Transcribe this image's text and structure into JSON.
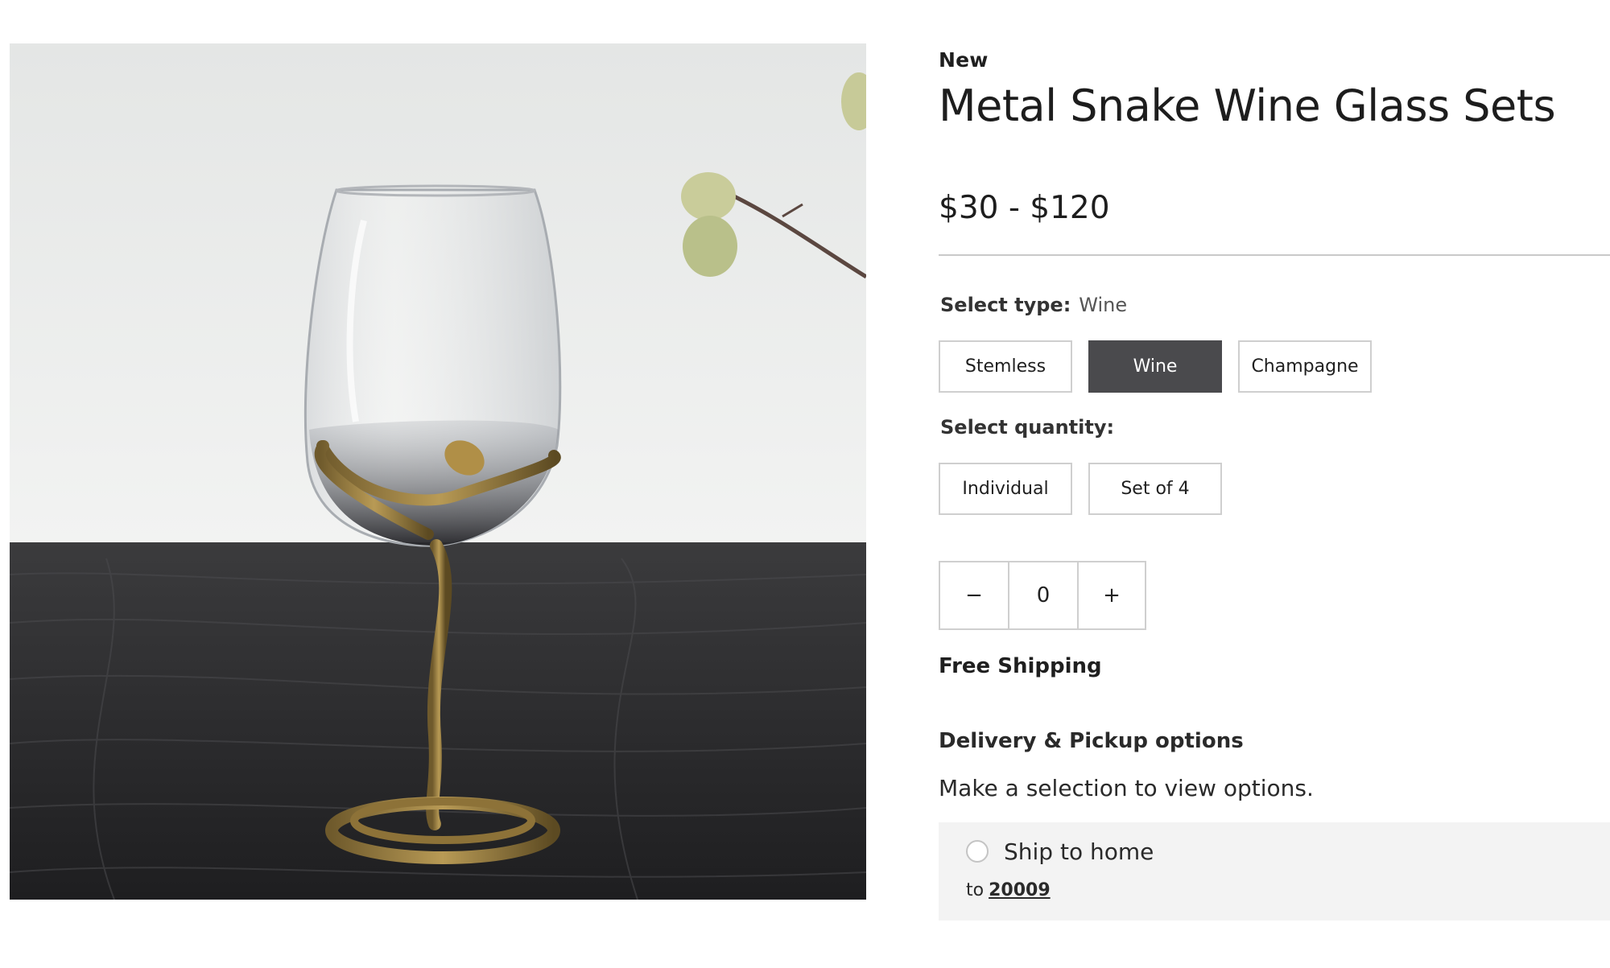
{
  "product": {
    "badge": "New",
    "title": "Metal Snake Wine Glass Sets",
    "price": "$30 - $120",
    "image_alt": "Metal snake wine glass on a dark wood table"
  },
  "type_selector": {
    "label": "Select type:",
    "selected": "Wine",
    "options": [
      "Stemless",
      "Wine",
      "Champagne"
    ]
  },
  "quantity_selector": {
    "label": "Select quantity:",
    "options": [
      "Individual",
      "Set of 4"
    ]
  },
  "stepper": {
    "decrement": "−",
    "value": "0",
    "increment": "+"
  },
  "shipping": {
    "free_shipping": "Free Shipping",
    "delivery_title": "Delivery & Pickup options",
    "hint": "Make a selection to view options.",
    "ship_to_home": "Ship to home",
    "to_prefix": "to",
    "zip": "20009"
  },
  "colors": {
    "selected_option_bg": "#4a4a4d",
    "panel_bg": "#f3f3f3",
    "border": "#cfcfcf"
  }
}
